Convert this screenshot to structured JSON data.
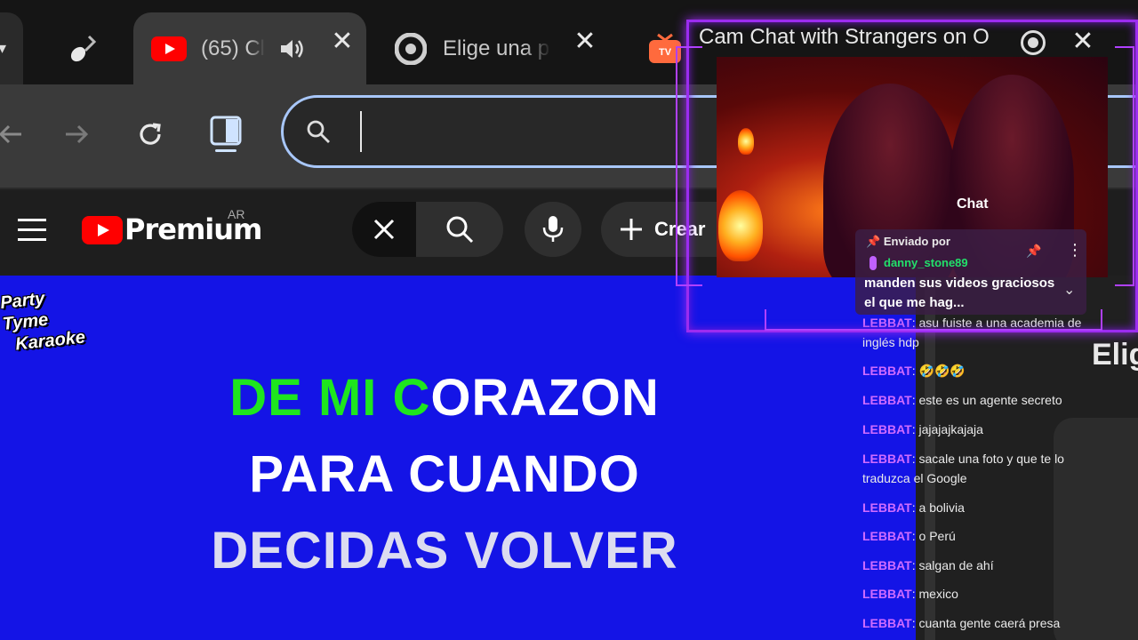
{
  "browser": {
    "tabs": [
      {
        "title": "(65) Cl",
        "icon": "youtube-icon",
        "audio": true,
        "active": true
      },
      {
        "title": "Elige una p",
        "icon": "chrome-icon"
      },
      {
        "title": "Cam Chat with Strangers on O",
        "icon": "ometv-icon"
      }
    ],
    "omnibox": {
      "value": ""
    }
  },
  "youtube": {
    "logo_text": "Premium",
    "country": "AR",
    "create_label": "Crear"
  },
  "video": {
    "logo_line1": "Party Tyme",
    "logo_line2": "Karaoke",
    "lyric1_sung": "DE MI C",
    "lyric1_unsung": "ORAZON",
    "lyric2": "PARA CUANDO",
    "lyric3": "DECIDAS VOLVER"
  },
  "right_page": {
    "heading_partial": "Elig"
  },
  "pip": {
    "chat_title": "Chat",
    "pinned": {
      "sent_by": "Enviado por",
      "user": "danny_stone89",
      "text": "manden sus videos graciosos  el que me hag..."
    }
  },
  "chat": {
    "messages": [
      {
        "user": "LEBBAT",
        "text": "asu fuiste a una academia de inglés hdp"
      },
      {
        "user": "LEBBAT",
        "text": "🤣🤣🤣"
      },
      {
        "user": "LEBBAT",
        "text": "este es un agente secreto"
      },
      {
        "user": "LEBBAT",
        "text": "jajajajkajaja"
      },
      {
        "user": "LEBBAT",
        "text": "sacale una foto y que te lo traduzca el Google"
      },
      {
        "user": "LEBBAT",
        "text": "a bolivia"
      },
      {
        "user": "LEBBAT",
        "text": "o Perú"
      },
      {
        "user": "LEBBAT",
        "text": "salgan de ahí"
      },
      {
        "user": "LEBBAT",
        "text": "mexico"
      },
      {
        "user": "LEBBAT",
        "text": "cuanta gente caerá presa"
      }
    ]
  },
  "colors": {
    "accent": "#a8c7fa",
    "karaoke_bg": "#1414e6",
    "sung_lyric": "#1ee61e",
    "chat_user": "#d06cff",
    "pip_border": "#9c2cf0",
    "pinned_user": "#22e06a"
  }
}
